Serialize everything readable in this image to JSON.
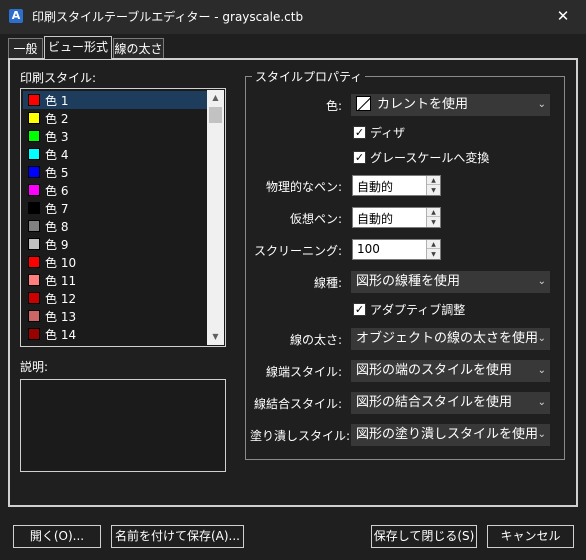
{
  "window": {
    "title": "印刷スタイルテーブルエディター - grayscale.ctb",
    "app_icon": "autocad-app-icon",
    "close_icon": "close-icon",
    "close_glyph": "✕"
  },
  "tabs": [
    {
      "label": "一般",
      "active": false
    },
    {
      "label": "ビュー形式",
      "active": true
    },
    {
      "label": "線の太さ",
      "active": false
    }
  ],
  "plot_styles": {
    "label": "印刷スタイル:",
    "items": [
      {
        "label": "色 1",
        "color": "#ff0000",
        "selected": true
      },
      {
        "label": "色 2",
        "color": "#ffff00",
        "selected": false
      },
      {
        "label": "色 3",
        "color": "#00ff00",
        "selected": false
      },
      {
        "label": "色 4",
        "color": "#00ffff",
        "selected": false
      },
      {
        "label": "色 5",
        "color": "#0000ff",
        "selected": false
      },
      {
        "label": "色 6",
        "color": "#ff00ff",
        "selected": false
      },
      {
        "label": "色 7",
        "color": "#000000",
        "selected": false
      },
      {
        "label": "色 8",
        "color": "#808080",
        "selected": false
      },
      {
        "label": "色 9",
        "color": "#c0c0c0",
        "selected": false
      },
      {
        "label": "色 10",
        "color": "#ff0000",
        "selected": false
      },
      {
        "label": "色 11",
        "color": "#ff7f7f",
        "selected": false
      },
      {
        "label": "色 12",
        "color": "#cc0000",
        "selected": false
      },
      {
        "label": "色 13",
        "color": "#cc6666",
        "selected": false
      },
      {
        "label": "色 14",
        "color": "#990000",
        "selected": false
      }
    ]
  },
  "description": {
    "label": "説明:",
    "value": ""
  },
  "properties": {
    "group_title": "スタイルプロパティ",
    "color_label": "色:",
    "color_value": "カレントを使用",
    "dither_label": "ディザ",
    "dither_checked": true,
    "grayscale_label": "グレースケールへ変換",
    "grayscale_checked": true,
    "physical_pen_label": "物理的なペン:",
    "physical_pen_value": "自動的",
    "virtual_pen_label": "仮想ペン:",
    "virtual_pen_value": "自動的",
    "screening_label": "スクリーニング:",
    "screening_value": "100",
    "linetype_label": "線種:",
    "linetype_value": "図形の線種を使用",
    "adaptive_label": "アダプティブ調整",
    "adaptive_checked": true,
    "lineweight_label": "線の太さ:",
    "lineweight_value": "オブジェクトの線の太さを使用",
    "line_end_label": "線端スタイル:",
    "line_end_value": "図形の端のスタイルを使用",
    "line_join_label": "線結合スタイル:",
    "line_join_value": "図形の結合スタイルを使用",
    "fill_label": "塗り潰しスタイル:",
    "fill_value": "図形の塗り潰しスタイルを使用"
  },
  "icons": {
    "chevron": "chevron-down-icon",
    "chevron_glyph": "⌄",
    "check_glyph": "✓",
    "spin_up_glyph": "▲",
    "spin_down_glyph": "▼",
    "scroll_up_glyph": "▲",
    "scroll_down_glyph": "▼"
  },
  "buttons": {
    "open": "開く(O)...",
    "save_as": "名前を付けて保存(A)...",
    "save_close": "保存して閉じる(S)",
    "cancel": "キャンセル"
  }
}
